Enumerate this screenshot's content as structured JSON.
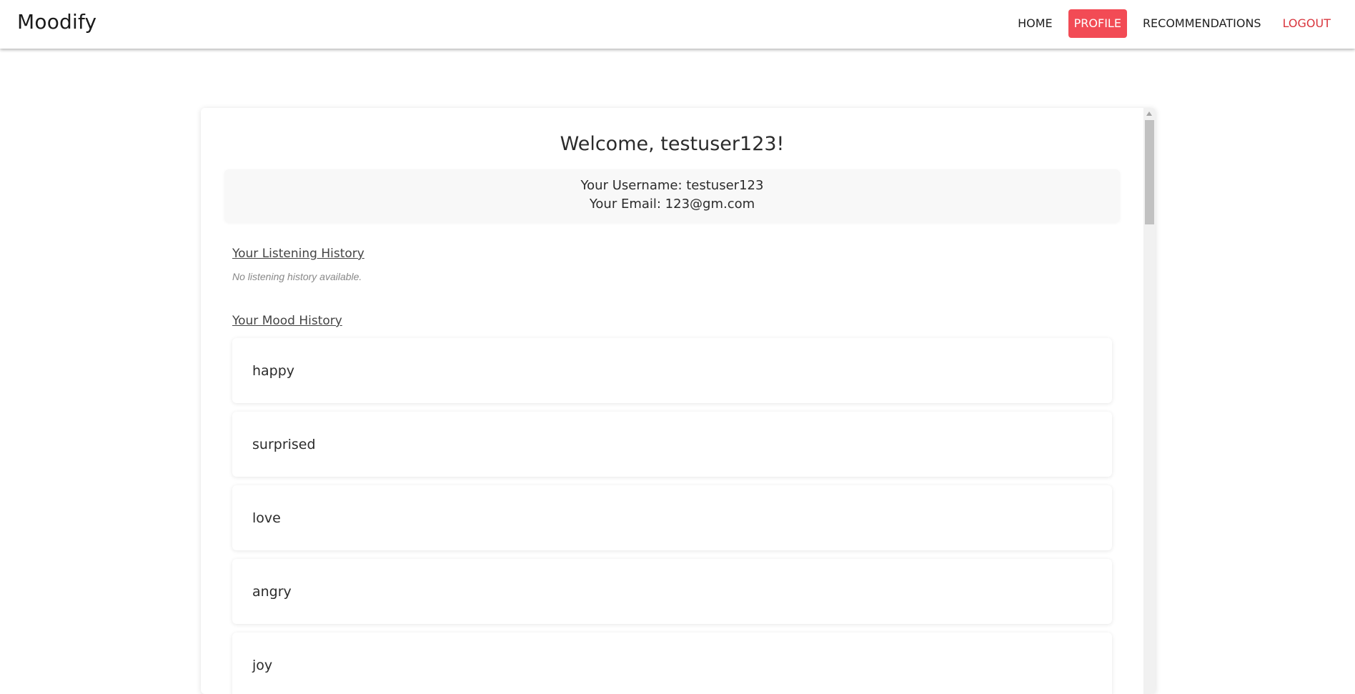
{
  "brand": "Moodify",
  "nav": {
    "home": "HOME",
    "profile": "PROFILE",
    "recommendations": "RECOMMENDATIONS",
    "logout": "LOGOUT"
  },
  "colors": {
    "accent": "#f24b55",
    "logout": "#d9363e"
  },
  "profile": {
    "welcome": "Welcome, testuser123!",
    "username_line": "Your Username: testuser123",
    "email_line": "Your Email: 123@gm.com"
  },
  "listening_history": {
    "title": "Your Listening History",
    "empty_text": "No listening history available."
  },
  "mood_history": {
    "title": "Your Mood History",
    "items": [
      "happy",
      "surprised",
      "love",
      "angry",
      "joy"
    ]
  }
}
